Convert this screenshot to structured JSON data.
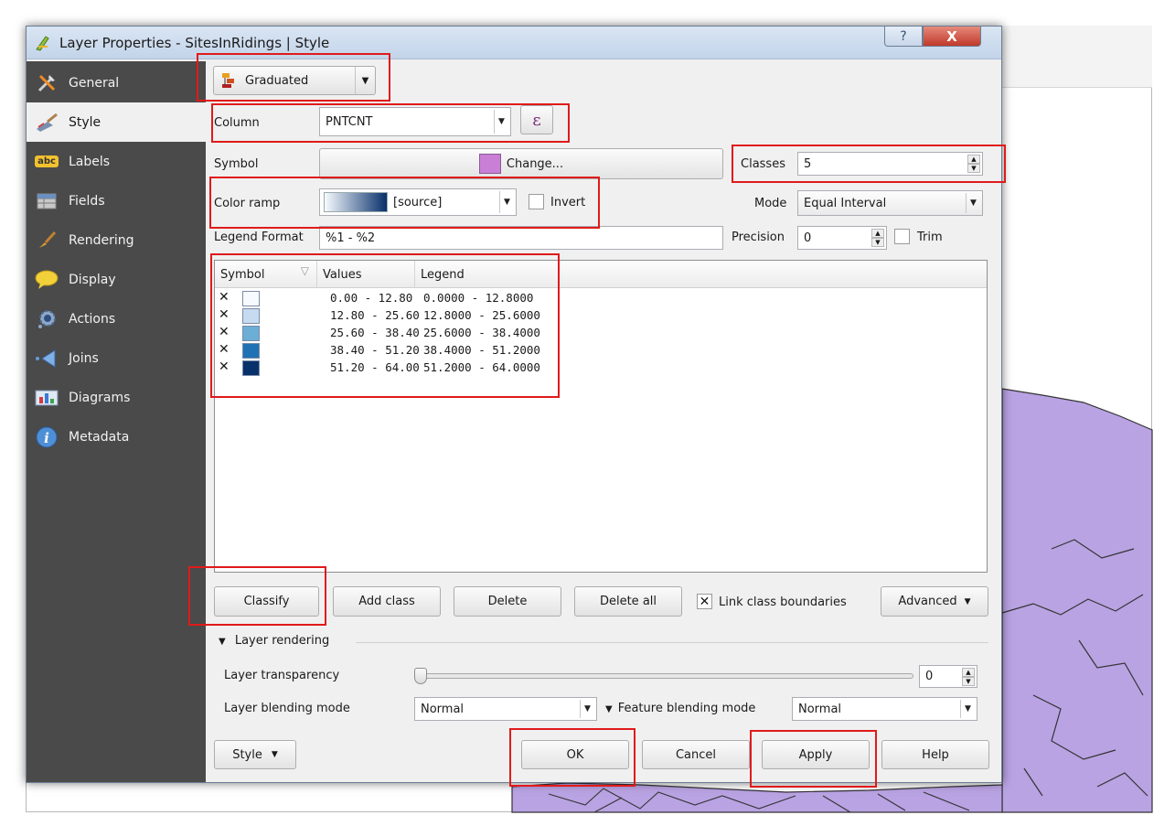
{
  "window": {
    "title": "Layer Properties - SitesInRidings | Style",
    "help_glyph": "?",
    "close_glyph": "X"
  },
  "sidebar": {
    "items": [
      {
        "label": "General",
        "icon": "wrench-hammer-icon"
      },
      {
        "label": "Style",
        "icon": "paintbrush-icon"
      },
      {
        "label": "Labels",
        "icon": "abc-label-icon"
      },
      {
        "label": "Fields",
        "icon": "table-icon"
      },
      {
        "label": "Rendering",
        "icon": "brush-icon"
      },
      {
        "label": "Display",
        "icon": "speech-bubble-icon"
      },
      {
        "label": "Actions",
        "icon": "gear-icon"
      },
      {
        "label": "Joins",
        "icon": "join-arrow-icon"
      },
      {
        "label": "Diagrams",
        "icon": "diagram-icon"
      },
      {
        "label": "Metadata",
        "icon": "info-icon"
      }
    ],
    "active": "Style"
  },
  "renderer": {
    "value": "Graduated",
    "icon": "graduated-icon"
  },
  "column": {
    "label": "Column",
    "value": "PNTCNT",
    "expression_glyph": "ε"
  },
  "symbol": {
    "label": "Symbol",
    "button_label": "Change...",
    "swatch_color": "#c97fd6"
  },
  "classes": {
    "label": "Classes",
    "value": "5"
  },
  "color_ramp": {
    "label": "Color ramp",
    "value": "[source]",
    "invert_label": "Invert",
    "from_color": "#f7fbff",
    "to_color": "#08306b"
  },
  "mode": {
    "label": "Mode",
    "value": "Equal Interval"
  },
  "legend_format": {
    "label": "Legend Format",
    "value": "%1 - %2"
  },
  "precision": {
    "label": "Precision",
    "value": "0",
    "trim_label": "Trim"
  },
  "table": {
    "headers": [
      "Symbol",
      "Values",
      "Legend"
    ],
    "rows": [
      {
        "values": "0.00 - 12.80",
        "legend": "0.0000 - 12.8000",
        "color": "#f7fbff"
      },
      {
        "values": "12.80 - 25.60",
        "legend": "12.8000 - 25.6000",
        "color": "#c6dbef"
      },
      {
        "values": "25.60 - 38.40",
        "legend": "25.6000 - 38.4000",
        "color": "#6baed6"
      },
      {
        "values": "38.40 - 51.20",
        "legend": "38.4000 - 51.2000",
        "color": "#2171b5"
      },
      {
        "values": "51.20 - 64.00",
        "legend": "51.2000 - 64.0000",
        "color": "#08306b"
      }
    ]
  },
  "class_buttons": {
    "classify": "Classify",
    "add_class": "Add class",
    "delete": "Delete",
    "delete_all": "Delete all",
    "link_label": "Link class boundaries",
    "advanced": "Advanced"
  },
  "layer_rendering": {
    "title": "Layer rendering",
    "transparency_label": "Layer transparency",
    "transparency_value": "0",
    "blending_label": "Layer blending mode",
    "blending_value": "Normal",
    "feature_blending_label": "Feature blending mode",
    "feature_blending_value": "Normal"
  },
  "footer": {
    "style": "Style",
    "ok": "OK",
    "cancel": "Cancel",
    "apply": "Apply",
    "help": "Help"
  },
  "colors": {
    "sidebar_bg": "#4a4a4a",
    "highlight_box": "#e01a1a",
    "map_fill": "#b9a3e3"
  }
}
